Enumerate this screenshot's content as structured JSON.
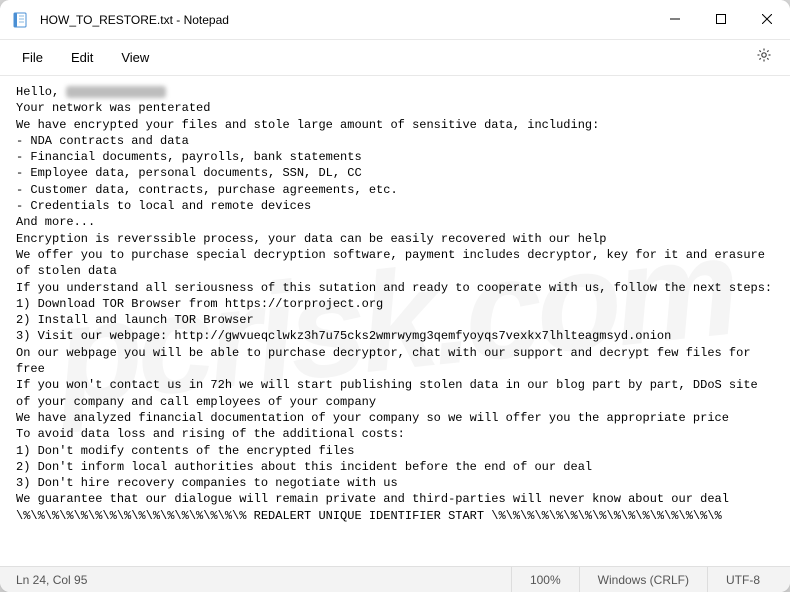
{
  "window": {
    "title": "HOW_TO_RESTORE.txt - Notepad"
  },
  "menubar": {
    "file": "File",
    "edit": "Edit",
    "view": "View"
  },
  "editor": {
    "greeting": "Hello, ",
    "line2": "Your network was penterated",
    "line3": "We have encrypted your files and stole large amount of sensitive data, including:",
    "b1": "- NDA contracts and data",
    "b2": "- Financial documents, payrolls, bank statements",
    "b3": "- Employee data, personal documents, SSN, DL, CC",
    "b4": "- Customer data, contracts, purchase agreements, etc.",
    "b5": "- Credentials to local and remote devices",
    "and_more": "And more...",
    "p1": "Encryption is reverssible process, your data can be easily recovered with our help",
    "p2": "We offer you to purchase special decryption software, payment includes decryptor, key for it and erasure of stolen data",
    "p3": "If you understand all seriousness of this sutation and ready to cooperate with us, follow the next steps:",
    "s1": "1) Download TOR Browser from https://torproject.org",
    "s2": "2) Install and launch TOR Browser",
    "s3": "3) Visit our webpage: http://gwvueqclwkz3h7u75cks2wmrwymg3qemfyoyqs7vexkx7lhlteagmsyd.onion",
    "p4": "On our webpage you will be able to purchase decryptor, chat with our support and decrypt few files for free",
    "p5": "If you won't contact us in 72h we will start publishing stolen data in our blog part by part, DDoS site of your company and call employees of your company",
    "p6": "We have analyzed financial documentation of your company so we will offer you the appropriate price",
    "p7": "To avoid data loss and rising of the additional costs:",
    "d1": "1) Don't modify contents of the encrypted files",
    "d2": "2) Don't inform local authorities about this incident before the end of our deal",
    "d3": "3) Don't hire recovery companies to negotiate with us",
    "p8": "We guarantee that our dialogue will remain private and third-parties will never know about our deal",
    "p9": "\\%\\%\\%\\%\\%\\%\\%\\%\\%\\%\\%\\%\\%\\%\\%\\% REDALERT UNIQUE IDENTIFIER START \\%\\%\\%\\%\\%\\%\\%\\%\\%\\%\\%\\%\\%\\%\\%\\%"
  },
  "statusbar": {
    "cursor": "Ln 24, Col 95",
    "zoom": "100%",
    "line_ending": "Windows (CRLF)",
    "encoding": "UTF-8"
  },
  "watermark": "pcrisk.com"
}
